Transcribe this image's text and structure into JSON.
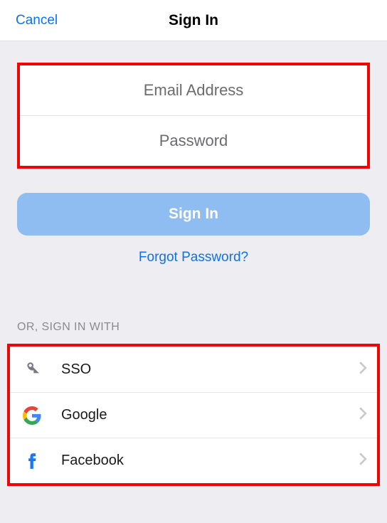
{
  "header": {
    "cancel": "Cancel",
    "title": "Sign In"
  },
  "form": {
    "email_placeholder": "Email Address",
    "password_placeholder": "Password"
  },
  "signin_button": "Sign In",
  "forgot_link": "Forgot Password?",
  "or_label": "OR, SIGN IN WITH",
  "providers": [
    {
      "icon": "key-icon",
      "label": "SSO"
    },
    {
      "icon": "google-icon",
      "label": "Google"
    },
    {
      "icon": "facebook-icon",
      "label": "Facebook"
    }
  ]
}
